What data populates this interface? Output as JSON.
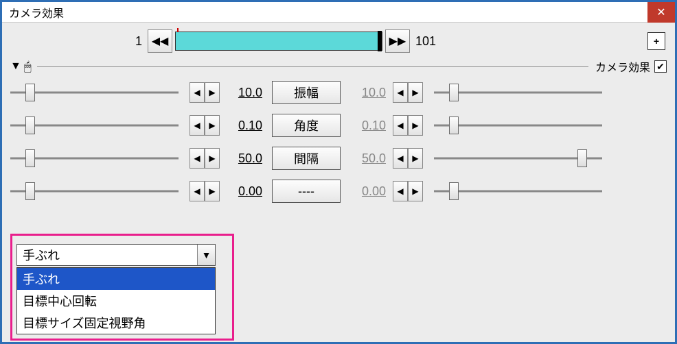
{
  "window": {
    "title": "カメラ効果"
  },
  "timeline": {
    "start": "1",
    "end": "101"
  },
  "section": {
    "checkbox_label": "カメラ効果",
    "checked": "✔"
  },
  "params": [
    {
      "left_val": "10.0",
      "label": "振幅",
      "right_val": "10.0",
      "lt": 12,
      "rt": 12
    },
    {
      "left_val": "0.10",
      "label": "角度",
      "right_val": "0.10",
      "lt": 12,
      "rt": 12
    },
    {
      "left_val": "50.0",
      "label": "間隔",
      "right_val": "50.0",
      "lt": 12,
      "rt": 88
    },
    {
      "left_val": "0.00",
      "label": "----",
      "right_val": "0.00",
      "lt": 12,
      "rt": 12
    }
  ],
  "combo": {
    "selected": "手ぶれ",
    "options": [
      "手ぶれ",
      "目標中心回転",
      "目標サイズ固定視野角"
    ]
  }
}
